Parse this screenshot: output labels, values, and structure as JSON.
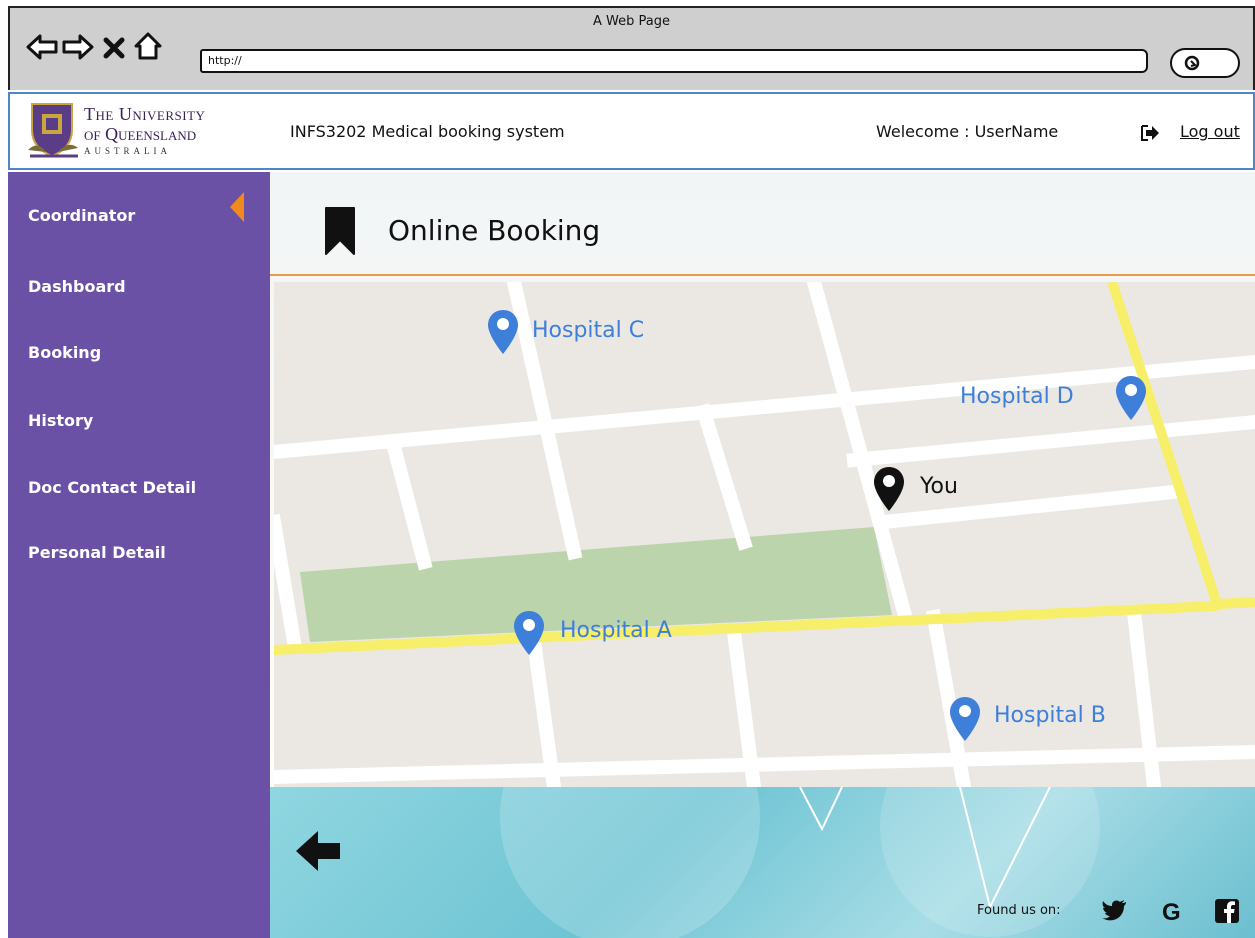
{
  "browser": {
    "title": "A Web Page",
    "url": "http://"
  },
  "header": {
    "logo_line1": "The University",
    "logo_line2": "of Queensland",
    "logo_line3": "AUSTRALIA",
    "system_title": "INFS3202 Medical booking system",
    "welcome": "Welecome :  UserName",
    "logout": "Log out"
  },
  "sidebar": {
    "items": [
      {
        "label": "Coordinator"
      },
      {
        "label": "Dashboard"
      },
      {
        "label": "Booking"
      },
      {
        "label": "History"
      },
      {
        "label": "Doc Contact Detail"
      },
      {
        "label": "Personal Detail"
      }
    ]
  },
  "main": {
    "title": "Online Booking",
    "map": {
      "pins": [
        {
          "label": "Hospital C",
          "color": "#3d7fd9"
        },
        {
          "label": "Hospital D",
          "color": "#3d7fd9"
        },
        {
          "label": "You",
          "color": "#111111"
        },
        {
          "label": "Hospital A",
          "color": "#3d7fd9"
        },
        {
          "label": "Hospital B",
          "color": "#3d7fd9"
        }
      ]
    }
  },
  "footer": {
    "found_us": "Found us on:",
    "social": [
      "twitter-icon",
      "google-icon",
      "facebook-icon"
    ]
  },
  "colors": {
    "sidebar": "#6a51a6",
    "accent_orange": "#f08a1c",
    "header_border": "#4e86c8",
    "pin_blue": "#3d7fd9",
    "road_yellow": "#f7ee6a",
    "park_green": "#bcd4ab"
  }
}
